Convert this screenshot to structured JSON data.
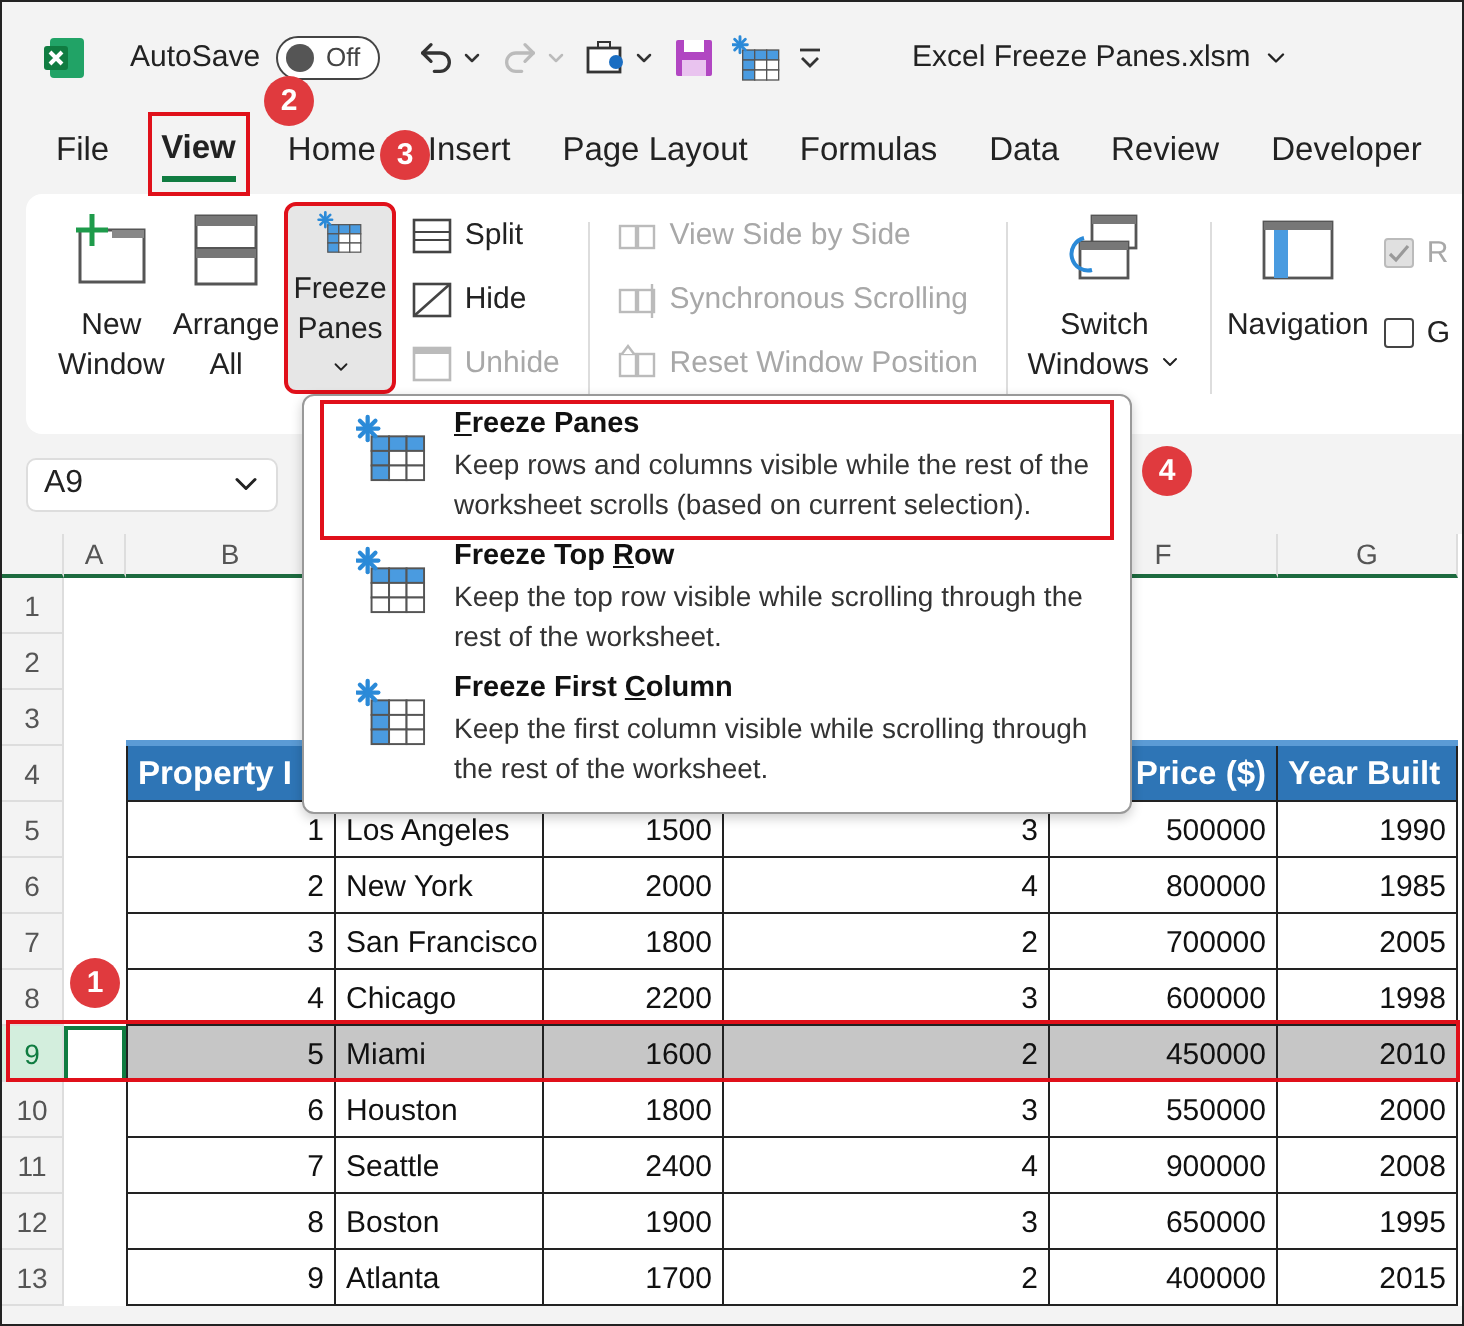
{
  "title_bar": {
    "autosave_label": "AutoSave",
    "autosave_toggle": {
      "on": false,
      "label": "Off"
    },
    "file_name": "Excel Freeze Panes.xlsm"
  },
  "tabs": [
    {
      "label": "File",
      "selected": false,
      "highlighted": false
    },
    {
      "label": "View",
      "selected": true,
      "highlighted": true
    },
    {
      "label": "Home",
      "selected": false,
      "highlighted": false
    },
    {
      "label": "Insert",
      "selected": false,
      "highlighted": false
    },
    {
      "label": "Page Layout",
      "selected": false,
      "highlighted": false
    },
    {
      "label": "Formulas",
      "selected": false,
      "highlighted": false
    },
    {
      "label": "Data",
      "selected": false,
      "highlighted": false
    },
    {
      "label": "Review",
      "selected": false,
      "highlighted": false
    },
    {
      "label": "Developer",
      "selected": false,
      "highlighted": false
    }
  ],
  "ribbon": {
    "large_buttons": [
      {
        "label": "New Window",
        "selected": false,
        "highlighted": false
      },
      {
        "label": "Arrange All",
        "selected": false,
        "highlighted": false
      },
      {
        "label": "Freeze Panes",
        "selected": true,
        "dropdown": true,
        "highlighted": true
      }
    ],
    "pane_buttons": [
      {
        "label": "Split",
        "disabled": false
      },
      {
        "label": "Hide",
        "disabled": false
      },
      {
        "label": "Unhide",
        "disabled": true
      }
    ],
    "window_buttons": [
      {
        "label": "View Side by Side",
        "disabled": true
      },
      {
        "label": "Synchronous Scrolling",
        "disabled": true
      },
      {
        "label": "Reset Window Position",
        "disabled": true
      }
    ],
    "switch_windows": {
      "label": "Switch Windows",
      "dropdown": true
    },
    "navigation": {
      "label": "Navigation"
    },
    "checkboxes": [
      {
        "label": "R",
        "checked": true,
        "disabled": true
      },
      {
        "label": "G",
        "checked": false,
        "disabled": false
      }
    ]
  },
  "name_box": {
    "value": "A9"
  },
  "freeze_menu": [
    {
      "access_key": "F",
      "title_after": "reeze Panes",
      "description": "Keep rows and columns visible while the rest of the worksheet scrolls (based on current selection).",
      "kind": "panes",
      "highlighted": true
    },
    {
      "title_before": "Freeze Top ",
      "access_key": "R",
      "title_after": "ow",
      "description": "Keep the top row visible while scrolling through the rest of the worksheet.",
      "kind": "top_row",
      "highlighted": false
    },
    {
      "title_before": "Freeze First ",
      "access_key": "C",
      "title_after": "olumn",
      "description": "Keep the first column visible while scrolling through the rest of the worksheet.",
      "kind": "first_column",
      "highlighted": false
    }
  ],
  "sheet": {
    "column_headers": {
      "left": [
        "A",
        "B"
      ],
      "right": [
        "F",
        "G"
      ]
    },
    "row_numbers": [
      "1",
      "2",
      "3",
      "4",
      "5",
      "6",
      "7",
      "8",
      "9",
      "10",
      "11",
      "12",
      "13"
    ],
    "table_header": {
      "first": "Property I",
      "last": [
        "Price ($)",
        "Year Built"
      ]
    },
    "rows": [
      {
        "cells": [
          "1",
          "Los Angeles",
          "1500",
          "3",
          "500000",
          "1990"
        ],
        "selected": false
      },
      {
        "cells": [
          "2",
          "New York",
          "2000",
          "4",
          "800000",
          "1985"
        ],
        "selected": false
      },
      {
        "cells": [
          "3",
          "San Francisco",
          "1800",
          "2",
          "700000",
          "2005"
        ],
        "selected": false
      },
      {
        "cells": [
          "4",
          "Chicago",
          "2200",
          "3",
          "600000",
          "1998"
        ],
        "selected": false
      },
      {
        "cells": [
          "5",
          "Miami",
          "1600",
          "2",
          "450000",
          "2010"
        ],
        "selected": true
      },
      {
        "cells": [
          "6",
          "Houston",
          "1800",
          "3",
          "550000",
          "2000"
        ],
        "selected": false
      },
      {
        "cells": [
          "7",
          "Seattle",
          "2400",
          "4",
          "900000",
          "2008"
        ],
        "selected": false
      },
      {
        "cells": [
          "8",
          "Boston",
          "1900",
          "3",
          "650000",
          "1995"
        ],
        "selected": false
      },
      {
        "cells": [
          "9",
          "Atlanta",
          "1700",
          "2",
          "400000",
          "2015"
        ],
        "selected": false
      }
    ]
  },
  "annotations": [
    {
      "number": "1"
    },
    {
      "number": "2"
    },
    {
      "number": "3"
    },
    {
      "number": "4"
    }
  ]
}
